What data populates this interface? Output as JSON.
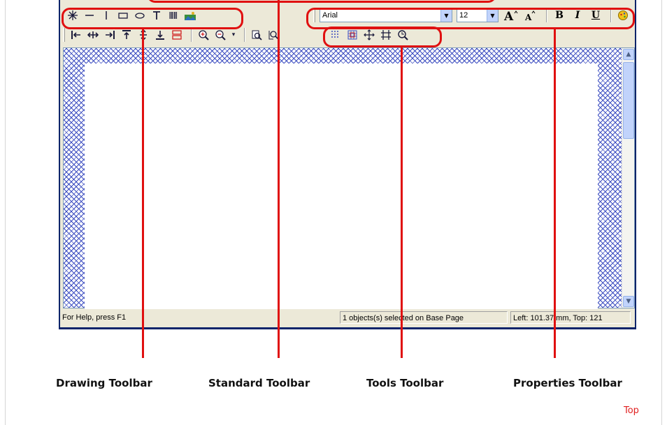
{
  "font_combo": {
    "value": "Arial"
  },
  "size_combo": {
    "value": "12"
  },
  "format_buttons": {
    "bold": "B",
    "italic": "I",
    "underline": "U"
  },
  "status_bar": {
    "help": "For Help, press F1",
    "selection": "1 objects(s) selected on Base Page",
    "position": "Left: 101.37 mm, Top: 121"
  },
  "labels": {
    "drawing": "Drawing Toolbar",
    "standard": "Standard Toolbar",
    "tools": "Tools Toolbar",
    "properties": "Properties Toolbar"
  },
  "top_link": "Top",
  "colors": {
    "callout": "#e01010",
    "link": "#e02020",
    "window_border": "#0a246a",
    "hatch": "#3b4cc0"
  },
  "icons": {
    "drawing": [
      "crosshair-icon",
      "horizontal-line-icon",
      "vertical-line-icon",
      "rectangle-icon",
      "ellipse-icon",
      "text-icon",
      "barcode-icon",
      "image-icon"
    ],
    "standard": [
      "align-left-icon",
      "center-horizontal-icon",
      "align-right-icon",
      "align-top-icon",
      "center-vertical-icon",
      "align-bottom-icon",
      "layers-icon",
      "zoom-in-icon",
      "zoom-out-icon",
      "zoom-dropdown-icon",
      "zoom-page-icon",
      "zoom-width-icon"
    ],
    "tools": [
      "grid-icon",
      "snap-grid-icon",
      "move-icon",
      "resize-icon",
      "magnify-icon"
    ],
    "properties": [
      "grow-font-icon",
      "shrink-font-icon",
      "color-icon"
    ]
  }
}
